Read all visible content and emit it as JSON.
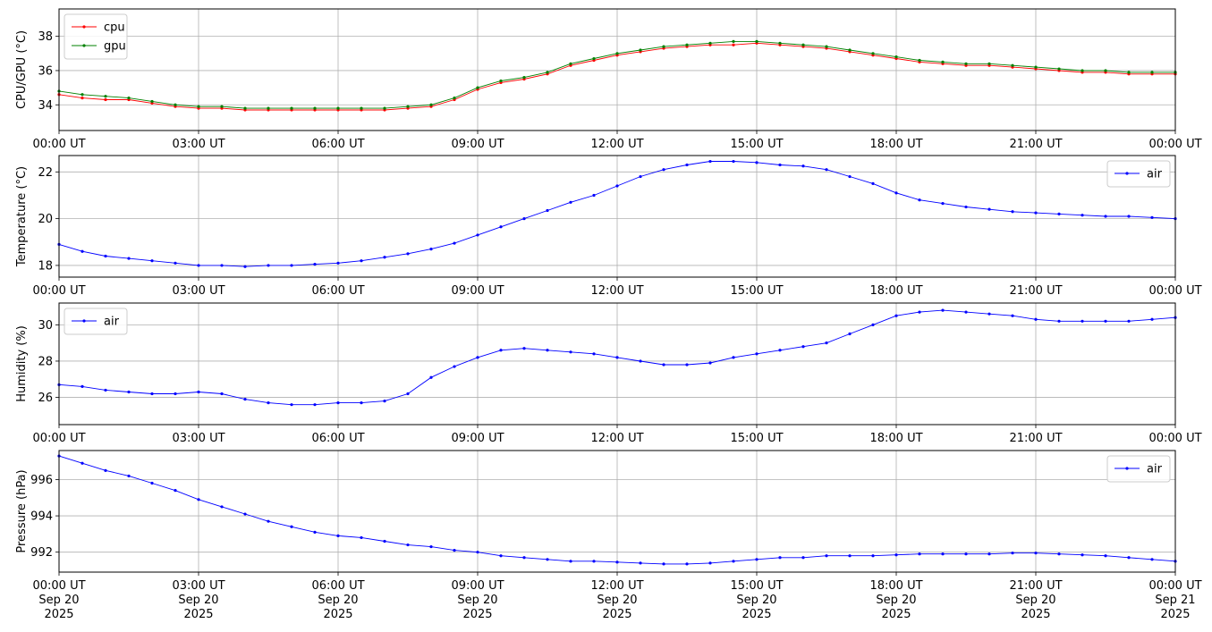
{
  "chart_data": [
    {
      "type": "line",
      "ylabel": "CPU/GPU (°C)",
      "ylim": [
        32.5,
        39.6
      ],
      "yticks": [
        34,
        36,
        38
      ],
      "grid": true,
      "legend": "top-left",
      "x_tick_labels": [
        "00:00 UT",
        "03:00 UT",
        "06:00 UT",
        "09:00 UT",
        "12:00 UT",
        "15:00 UT",
        "18:00 UT",
        "21:00 UT",
        "00:00 UT"
      ],
      "series": [
        {
          "name": "cpu",
          "color": "#ff0000",
          "x_hours": [
            0,
            0.5,
            1,
            1.5,
            2,
            2.5,
            3,
            3.5,
            4,
            4.5,
            5,
            5.5,
            6,
            6.5,
            7,
            7.5,
            8,
            8.5,
            9,
            9.5,
            10,
            10.5,
            11,
            11.5,
            12,
            12.5,
            13,
            13.5,
            14,
            14.5,
            15,
            15.5,
            16,
            16.5,
            17,
            17.5,
            18,
            18.5,
            19,
            19.5,
            20,
            20.5,
            21,
            21.5,
            22,
            22.5,
            23,
            23.5,
            24
          ],
          "values": [
            34.6,
            34.4,
            34.3,
            34.3,
            34.1,
            33.9,
            33.8,
            33.8,
            33.7,
            33.7,
            33.7,
            33.7,
            33.7,
            33.7,
            33.7,
            33.8,
            33.9,
            34.3,
            34.9,
            35.3,
            35.5,
            35.8,
            36.3,
            36.6,
            36.9,
            37.1,
            37.3,
            37.4,
            37.5,
            37.5,
            37.6,
            37.5,
            37.4,
            37.3,
            37.1,
            36.9,
            36.7,
            36.5,
            36.4,
            36.3,
            36.3,
            36.2,
            36.1,
            36.0,
            35.9,
            35.9,
            35.8,
            35.8,
            35.8
          ]
        },
        {
          "name": "gpu",
          "color": "#008000",
          "x_hours": [
            0,
            0.5,
            1,
            1.5,
            2,
            2.5,
            3,
            3.5,
            4,
            4.5,
            5,
            5.5,
            6,
            6.5,
            7,
            7.5,
            8,
            8.5,
            9,
            9.5,
            10,
            10.5,
            11,
            11.5,
            12,
            12.5,
            13,
            13.5,
            14,
            14.5,
            15,
            15.5,
            16,
            16.5,
            17,
            17.5,
            18,
            18.5,
            19,
            19.5,
            20,
            20.5,
            21,
            21.5,
            22,
            22.5,
            23,
            23.5,
            24
          ],
          "values": [
            34.8,
            34.6,
            34.5,
            34.4,
            34.2,
            34.0,
            33.9,
            33.9,
            33.8,
            33.8,
            33.8,
            33.8,
            33.8,
            33.8,
            33.8,
            33.9,
            34.0,
            34.4,
            35.0,
            35.4,
            35.6,
            35.9,
            36.4,
            36.7,
            37.0,
            37.2,
            37.4,
            37.5,
            37.6,
            37.7,
            37.7,
            37.6,
            37.5,
            37.4,
            37.2,
            37.0,
            36.8,
            36.6,
            36.5,
            36.4,
            36.4,
            36.3,
            36.2,
            36.1,
            36.0,
            36.0,
            35.9,
            35.9,
            35.9
          ]
        }
      ]
    },
    {
      "type": "line",
      "ylabel": "Temperature (°C)",
      "ylim": [
        17.5,
        22.7
      ],
      "yticks": [
        18,
        20,
        22
      ],
      "grid": true,
      "legend": "top-right",
      "x_tick_labels": [
        "00:00 UT",
        "03:00 UT",
        "06:00 UT",
        "09:00 UT",
        "12:00 UT",
        "15:00 UT",
        "18:00 UT",
        "21:00 UT",
        "00:00 UT"
      ],
      "series": [
        {
          "name": "air",
          "color": "#0000ff",
          "x_hours": [
            0,
            0.5,
            1,
            1.5,
            2,
            2.5,
            3,
            3.5,
            4,
            4.5,
            5,
            5.5,
            6,
            6.5,
            7,
            7.5,
            8,
            8.5,
            9,
            9.5,
            10,
            10.5,
            11,
            11.5,
            12,
            12.5,
            13,
            13.5,
            14,
            14.5,
            15,
            15.5,
            16,
            16.5,
            17,
            17.5,
            18,
            18.5,
            19,
            19.5,
            20,
            20.5,
            21,
            21.5,
            22,
            22.5,
            23,
            23.5,
            24
          ],
          "values": [
            18.9,
            18.6,
            18.4,
            18.3,
            18.2,
            18.1,
            18.0,
            18.0,
            17.95,
            18.0,
            18.0,
            18.05,
            18.1,
            18.2,
            18.35,
            18.5,
            18.7,
            18.95,
            19.3,
            19.65,
            20.0,
            20.35,
            20.7,
            21.0,
            21.4,
            21.8,
            22.1,
            22.3,
            22.45,
            22.45,
            22.4,
            22.3,
            22.25,
            22.1,
            21.8,
            21.5,
            21.1,
            20.8,
            20.65,
            20.5,
            20.4,
            20.3,
            20.25,
            20.2,
            20.15,
            20.1,
            20.1,
            20.05,
            20.0
          ]
        }
      ]
    },
    {
      "type": "line",
      "ylabel": "Humidity (%)",
      "ylim": [
        24.5,
        31.2
      ],
      "yticks": [
        26,
        28,
        30
      ],
      "grid": true,
      "legend": "top-left",
      "x_tick_labels": [
        "00:00 UT",
        "03:00 UT",
        "06:00 UT",
        "09:00 UT",
        "12:00 UT",
        "15:00 UT",
        "18:00 UT",
        "21:00 UT",
        "00:00 UT"
      ],
      "series": [
        {
          "name": "air",
          "color": "#0000ff",
          "x_hours": [
            0,
            0.5,
            1,
            1.5,
            2,
            2.5,
            3,
            3.5,
            4,
            4.5,
            5,
            5.5,
            6,
            6.5,
            7,
            7.5,
            8,
            8.5,
            9,
            9.5,
            10,
            10.5,
            11,
            11.5,
            12,
            12.5,
            13,
            13.5,
            14,
            14.5,
            15,
            15.5,
            16,
            16.5,
            17,
            17.5,
            18,
            18.5,
            19,
            19.5,
            20,
            20.5,
            21,
            21.5,
            22,
            22.5,
            23,
            23.5,
            24
          ],
          "values": [
            26.7,
            26.6,
            26.4,
            26.3,
            26.2,
            26.2,
            26.3,
            26.2,
            25.9,
            25.7,
            25.6,
            25.6,
            25.7,
            25.7,
            25.8,
            26.2,
            27.1,
            27.7,
            28.2,
            28.6,
            28.7,
            28.6,
            28.5,
            28.4,
            28.2,
            28.0,
            27.8,
            27.8,
            27.9,
            28.2,
            28.4,
            28.6,
            28.8,
            29.0,
            29.5,
            30.0,
            30.5,
            30.7,
            30.8,
            30.7,
            30.6,
            30.5,
            30.3,
            30.2,
            30.2,
            30.2,
            30.2,
            30.3,
            30.4
          ]
        }
      ]
    },
    {
      "type": "line",
      "ylabel": "Pressure (hPa)",
      "ylim": [
        990.9,
        997.6
      ],
      "yticks": [
        992,
        994,
        996
      ],
      "grid": true,
      "legend": "top-right",
      "x_tick_labels": [
        "00:00 UT\nSep 20\n2025",
        "03:00 UT\nSep 20\n2025",
        "06:00 UT\nSep 20\n2025",
        "09:00 UT\nSep 20\n2025",
        "12:00 UT\nSep 20\n2025",
        "15:00 UT\nSep 20\n2025",
        "18:00 UT\nSep 20\n2025",
        "21:00 UT\nSep 20\n2025",
        "00:00 UT\nSep 21\n2025"
      ],
      "series": [
        {
          "name": "air",
          "color": "#0000ff",
          "x_hours": [
            0,
            0.5,
            1,
            1.5,
            2,
            2.5,
            3,
            3.5,
            4,
            4.5,
            5,
            5.5,
            6,
            6.5,
            7,
            7.5,
            8,
            8.5,
            9,
            9.5,
            10,
            10.5,
            11,
            11.5,
            12,
            12.5,
            13,
            13.5,
            14,
            14.5,
            15,
            15.5,
            16,
            16.5,
            17,
            17.5,
            18,
            18.5,
            19,
            19.5,
            20,
            20.5,
            21,
            21.5,
            22,
            22.5,
            23,
            23.5,
            24
          ],
          "values": [
            997.3,
            996.9,
            996.5,
            996.2,
            995.8,
            995.4,
            994.9,
            994.5,
            994.1,
            993.7,
            993.4,
            993.1,
            992.9,
            992.8,
            992.6,
            992.4,
            992.3,
            992.1,
            992.0,
            991.8,
            991.7,
            991.6,
            991.5,
            991.5,
            991.45,
            991.4,
            991.35,
            991.35,
            991.4,
            991.5,
            991.6,
            991.7,
            991.7,
            991.8,
            991.8,
            991.8,
            991.85,
            991.9,
            991.9,
            991.9,
            991.9,
            991.95,
            991.95,
            991.9,
            991.85,
            991.8,
            991.7,
            991.6,
            991.5
          ]
        }
      ]
    }
  ]
}
